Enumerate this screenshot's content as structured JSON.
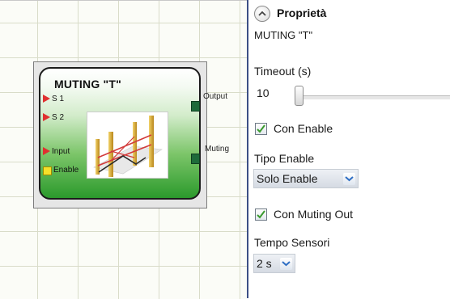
{
  "canvas": {
    "block": {
      "title": "MUTING \"T\"",
      "inputs": [
        {
          "label": "S 1"
        },
        {
          "label": "S 2"
        },
        {
          "label": "Input"
        },
        {
          "label": "Enable"
        }
      ],
      "outputs": [
        {
          "label": "Output"
        },
        {
          "label": "Muting"
        }
      ]
    }
  },
  "properties": {
    "title": "Proprietà",
    "subtitle": "MUTING \"T\"",
    "timeout": {
      "label": "Timeout (s)",
      "value": "10"
    },
    "con_enable": {
      "label": "Con Enable",
      "checked": true
    },
    "tipo_enable": {
      "label": "Tipo Enable",
      "selected": "Solo Enable"
    },
    "con_muting_out": {
      "label": "Con Muting Out",
      "checked": true
    },
    "tempo_sensori": {
      "label": "Tempo Sensori",
      "selected": "2 s"
    }
  },
  "colors": {
    "divider": "#3c4f86",
    "block_green": "#2b9a2c",
    "input_pin": "#e03030",
    "enable_pin": "#f5e02a",
    "output_pin": "#1e6b3a",
    "checkmark": "#3a9a2e"
  }
}
